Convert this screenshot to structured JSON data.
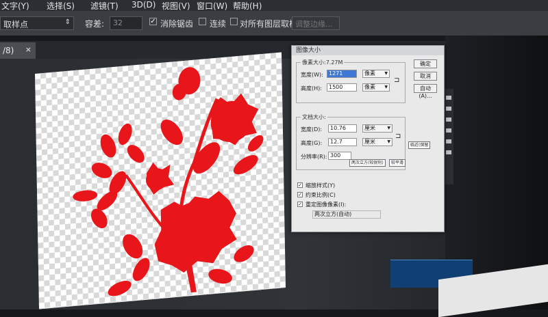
{
  "menubar": {
    "items": [
      "文字(Y)",
      "选择(S)",
      "滤镜(T)",
      "3D(D)",
      "视图(V)",
      "窗口(W)",
      "帮助(H)"
    ]
  },
  "options": {
    "sample_select": "取样点",
    "tolerance_label": "容差:",
    "tolerance_value": "32",
    "anti_alias_label": "消除锯齿",
    "contiguous_label": "连续",
    "sample_all_label": "对所有图层取样",
    "refine_edge_label": "调整边缘..."
  },
  "tab": {
    "label": "/8)",
    "close": "×"
  },
  "dialog": {
    "title": "图像大小",
    "pixel_dims_label": "像素大小:7.27M",
    "px_width_label": "宽度(W):",
    "px_width_value": "1271",
    "px_height_label": "高度(H):",
    "px_height_value": "1500",
    "px_unit": "像素",
    "doc_size_label": "文档大小:",
    "doc_width_label": "宽度(D):",
    "doc_width_value": "10.76",
    "doc_height_label": "高度(G):",
    "doc_height_value": "12.7",
    "doc_unit": "厘米",
    "resolution_label": "分辨率(R):",
    "resolution_value": "300",
    "btn_ok": "确定",
    "btn_cancel": "取消",
    "btn_auto": "自动(A)...",
    "scale_styles_label": "缩放样式(Y)",
    "constrain_label": "约束比例(C)",
    "resample_label": "重定图像像素(I):",
    "resample_method": "两次立方(自动)",
    "tooltip_a": "两次立方(较锐利)",
    "tooltip_b": "较平滑",
    "tooltip_c": "临近(保留"
  },
  "colors": {
    "silhouette": "#e8151a",
    "selection": "#3e78d2"
  },
  "icons": [
    "chevron-down-icon",
    "checkbox-icon",
    "link-chain-icon",
    "close-icon"
  ]
}
